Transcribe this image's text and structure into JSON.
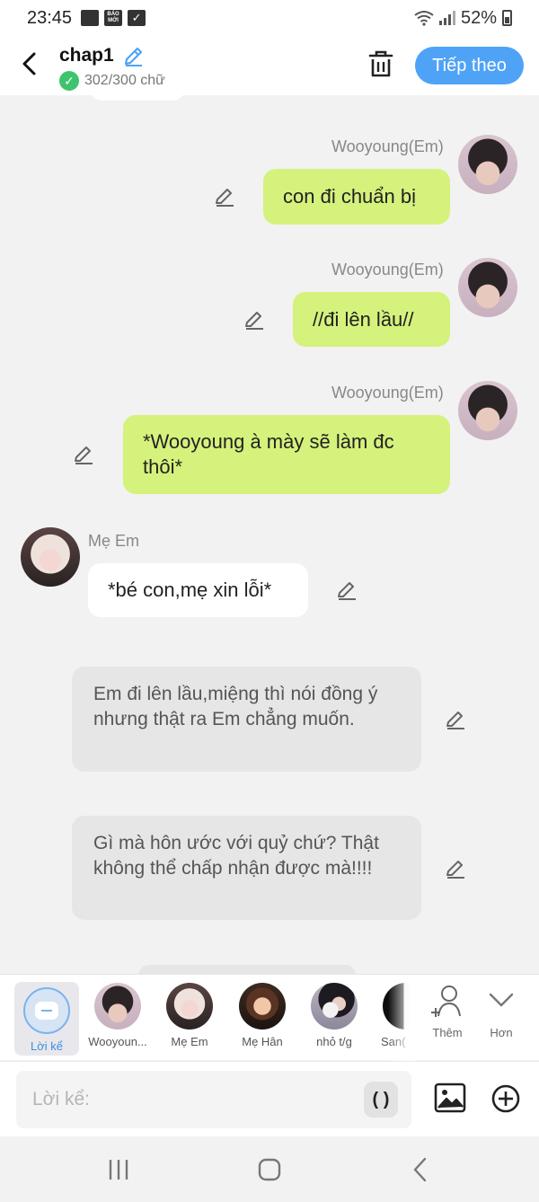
{
  "status_bar": {
    "time": "23:45",
    "news_badge": "BÁO MỚI",
    "battery": "52%"
  },
  "header": {
    "title": "chap1",
    "word_count": "302/300 chữ",
    "next_button": "Tiếp theo"
  },
  "messages": [
    {
      "sender": "Wooyoung(Em)",
      "text": "con đi chuẩn bị"
    },
    {
      "sender": "Wooyoung(Em)",
      "text": "//đi lên lầu//"
    },
    {
      "sender": "Wooyoung(Em)",
      "text": "*Wooyoung à mày sẽ làm đc thôi*"
    },
    {
      "sender": "Mẹ Em",
      "text": "*bé con,mẹ xin lỗi*"
    }
  ],
  "narrations": [
    {
      "text": "Em đi lên lầu,miệng thì nói đồng ý nhưng thật ra Em chẳng muốn."
    },
    {
      "text": "Gì mà hôn ước với quỷ chứ? Thật không thể chấp nhận được mà!!!!"
    }
  ],
  "characters": [
    {
      "name": "Lời kể"
    },
    {
      "name": "Wooyoun..."
    },
    {
      "name": "Mẹ Em"
    },
    {
      "name": "Mẹ Hân"
    },
    {
      "name": "nhỏ t/g"
    },
    {
      "name": "San("
    }
  ],
  "actions": {
    "add_label": "Thêm",
    "more_label": "Hơn"
  },
  "input": {
    "placeholder": "Lời kể:",
    "paren_button": "( )"
  },
  "colors": {
    "accent": "#4fa3f7",
    "bubble_green": "#d5f27c",
    "check_green": "#3ec46d"
  }
}
